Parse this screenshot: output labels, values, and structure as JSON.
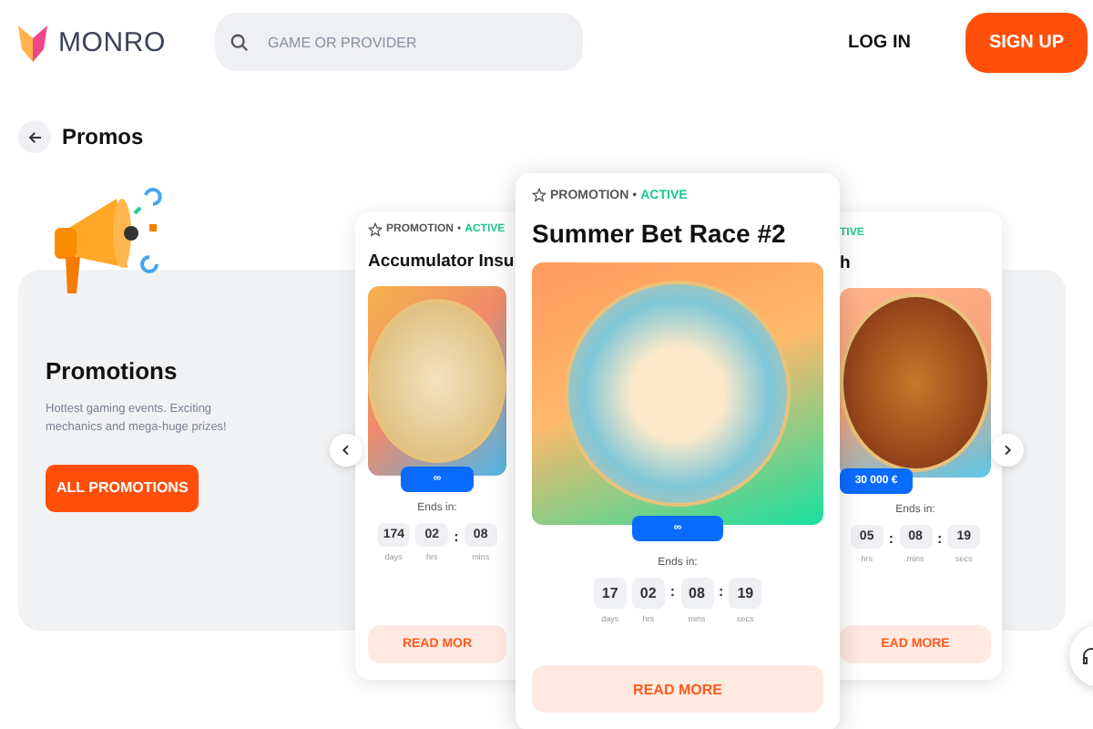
{
  "header": {
    "logo": "MONRO",
    "search": {
      "placeholder": "GAME OR PROVIDER"
    },
    "login": "LOG IN",
    "signup": "SIGN UP"
  },
  "page": {
    "title": "Promos"
  },
  "intro": {
    "title": "Promotions",
    "description": "Hottest gaming events. Exciting mechanics and mega-huge prizes!",
    "button": "ALL PROMOTIONS"
  },
  "cards": [
    {
      "selected": false,
      "category": "PROMOTION",
      "dot": "•",
      "status": "ACTIVE",
      "title": "Accumulator Insu",
      "badge": "∞",
      "ends_label": "Ends in:",
      "timer": [
        {
          "value": "174",
          "unit": "days"
        },
        {
          "value": "02",
          "unit": "hrs"
        },
        {
          "separator": ":",
          "value": "08",
          "unit": "mins"
        }
      ],
      "button": "READ MOR"
    },
    {
      "selected": true,
      "category": "PROMOTION",
      "dot": "•",
      "status": "ACTIVE",
      "title": "Summer Bet Race #2",
      "badge": "∞",
      "ends_label": "Ends in:",
      "timer": [
        {
          "value": "17",
          "unit": "days"
        },
        {
          "value": "02",
          "unit": "hrs"
        },
        {
          "separator": ":",
          "value": "08",
          "unit": "mins"
        },
        {
          "separator": ":",
          "value": "19",
          "unit": "secs"
        }
      ],
      "button": "READ MORE"
    },
    {
      "selected": false,
      "status": "TIVE",
      "title": "h",
      "badge": "30 000 €",
      "ends_label": "Ends in:",
      "timer": [
        {
          "value": "05",
          "unit": "hrs"
        },
        {
          "separator": ":",
          "value": "08",
          "unit": "mins"
        },
        {
          "separator": ":",
          "value": "19",
          "unit": "secs"
        }
      ],
      "button": "EAD MORE"
    }
  ]
}
